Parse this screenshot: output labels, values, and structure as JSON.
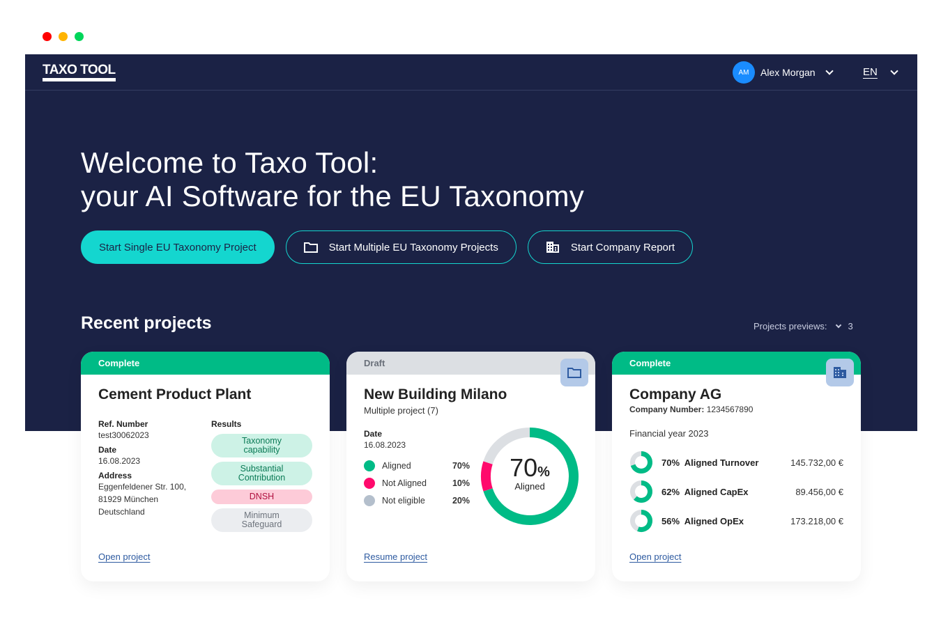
{
  "window": {
    "dots": [
      "#ff0000",
      "#ffb400",
      "#00d65a"
    ]
  },
  "header": {
    "logo": "TAXO TOOL",
    "user_initials": "AM",
    "user_name": "Alex Morgan",
    "language": "EN"
  },
  "hero": {
    "title_line1": "Welcome to Taxo Tool:",
    "title_line2": "your AI Software for the EU Taxonomy",
    "buttons": [
      {
        "label": "Start Single EU Taxonomy Project"
      },
      {
        "label": "Start Multiple EU Taxonomy Projects",
        "icon": "folder-icon"
      },
      {
        "label": "Start Company Report",
        "icon": "building-icon"
      }
    ]
  },
  "recent": {
    "title": "Recent projects",
    "previews_label": "Projects previews:",
    "previews_value": "3"
  },
  "colors": {
    "navy": "#1b2245",
    "accent": "#14d6cf",
    "green": "#00bb86",
    "pink": "#ff0a6c",
    "gray": "#dcdfe3",
    "link": "#2d5aa0"
  },
  "cards": [
    {
      "status": "Complete",
      "title": "Cement Product Plant",
      "ref_label": "Ref. Number",
      "ref": "test30062023",
      "date_label": "Date",
      "date": "16.08.2023",
      "address_label": "Address",
      "address": [
        "Eggenfeldener Str. 100,",
        "81929 München",
        "Deutschland"
      ],
      "results_label": "Results",
      "results": [
        {
          "line1": "Taxonomy",
          "line2": "capability",
          "state": "pass"
        },
        {
          "line1": "Substantial",
          "line2": "Contribution",
          "state": "pass"
        },
        {
          "line1": "DNSH",
          "line2": "",
          "state": "fail"
        },
        {
          "line1": "Minimum",
          "line2": "Safeguard",
          "state": "pending"
        }
      ],
      "link": "Open project"
    },
    {
      "status": "Draft",
      "title": "New Building Milano",
      "subtitle": "Multiple project (7)",
      "date_label": "Date",
      "date": "16.08.2023",
      "legend": [
        {
          "label": "Aligned",
          "value": "70%",
          "pct": 70,
          "color": "#00bb86"
        },
        {
          "label": "Not Aligned",
          "value": "10%",
          "pct": 10,
          "color": "#ff0a6c"
        },
        {
          "label": "Not eligible",
          "value": "20%",
          "pct": 20,
          "color": "#dcdfe3"
        }
      ],
      "donut_value": "70",
      "donut_unit": "%",
      "donut_label": "Aligned",
      "link": "Resume project",
      "icon": "folder-icon"
    },
    {
      "status": "Complete",
      "title": "Company AG",
      "number_label": "Company Number:",
      "number": "1234567890",
      "year": "Financial year 2023",
      "metrics": [
        {
          "pct_label": "70%",
          "pct": 70,
          "label": "Aligned Turnover",
          "value": "145.732,00 €"
        },
        {
          "pct_label": "62%",
          "pct": 62,
          "label": "Aligned CapEx",
          "value": "89.456,00 €"
        },
        {
          "pct_label": "56%",
          "pct": 56,
          "label": "Aligned OpEx",
          "value": "173.218,00 €"
        }
      ],
      "link": "Open project",
      "icon": "building-icon"
    }
  ]
}
